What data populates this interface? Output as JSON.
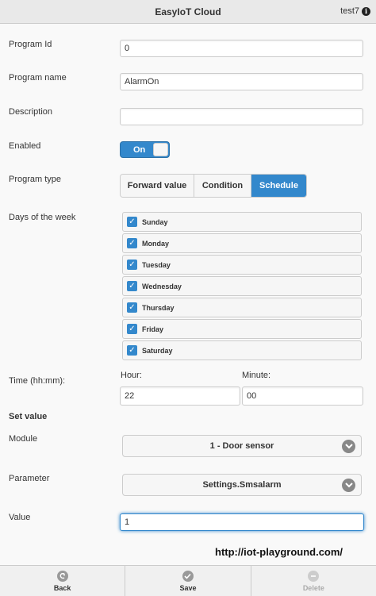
{
  "header": {
    "title": "EasyIoT Cloud",
    "user": "test7"
  },
  "form": {
    "program_id": {
      "label": "Program Id",
      "value": "0"
    },
    "program_name": {
      "label": "Program name",
      "value": "AlarmOn"
    },
    "description": {
      "label": "Description",
      "value": ""
    },
    "enabled": {
      "label": "Enabled",
      "state": "On"
    },
    "program_type": {
      "label": "Program type",
      "options": [
        "Forward value",
        "Condition",
        "Schedule"
      ],
      "selected": "Schedule"
    },
    "days": {
      "label": "Days of the week",
      "items": [
        "Sunday",
        "Monday",
        "Tuesday",
        "Wednesday",
        "Thursday",
        "Friday",
        "Saturday"
      ]
    },
    "time": {
      "label": "Time (hh:mm):",
      "hour_label": "Hour:",
      "hour_value": "22",
      "minute_label": "Minute:",
      "minute_value": "00"
    },
    "set_value": {
      "heading": "Set value"
    },
    "module": {
      "label": "Module",
      "selected": "1 - Door sensor"
    },
    "parameter": {
      "label": "Parameter",
      "selected": "Settings.Smsalarm"
    },
    "value": {
      "label": "Value",
      "value": "1"
    }
  },
  "link": "http://iot-playground.com/",
  "footer": {
    "back": "Back",
    "save": "Save",
    "delete": "Delete"
  },
  "colors": {
    "accent": "#3388cc"
  }
}
